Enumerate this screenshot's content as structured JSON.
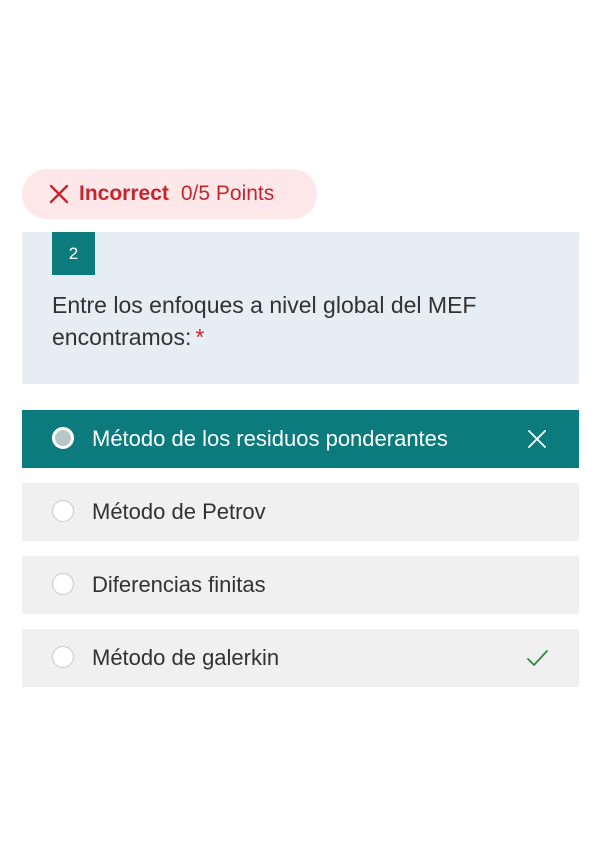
{
  "result": {
    "status": "Incorrect",
    "points": "0/5 Points"
  },
  "question": {
    "number": "2",
    "text": "Entre los enfoques a nivel global del MEF encontramos:",
    "required_marker": "*"
  },
  "options": [
    {
      "label": "Método de los residuos ponderantes",
      "selected": true,
      "mark": "x-icon"
    },
    {
      "label": "Método de Petrov",
      "selected": false,
      "mark": ""
    },
    {
      "label": "Diferencias finitas",
      "selected": false,
      "mark": ""
    },
    {
      "label": "Método de galerkin",
      "selected": false,
      "mark": "check-icon"
    }
  ],
  "colors": {
    "accent": "#0b7b7d",
    "error": "#c4262e",
    "error_bg": "#fde7e9",
    "correct": "#2e8b3e",
    "card_bg": "#e7eef3",
    "option_bg": "#f0f0f0"
  }
}
